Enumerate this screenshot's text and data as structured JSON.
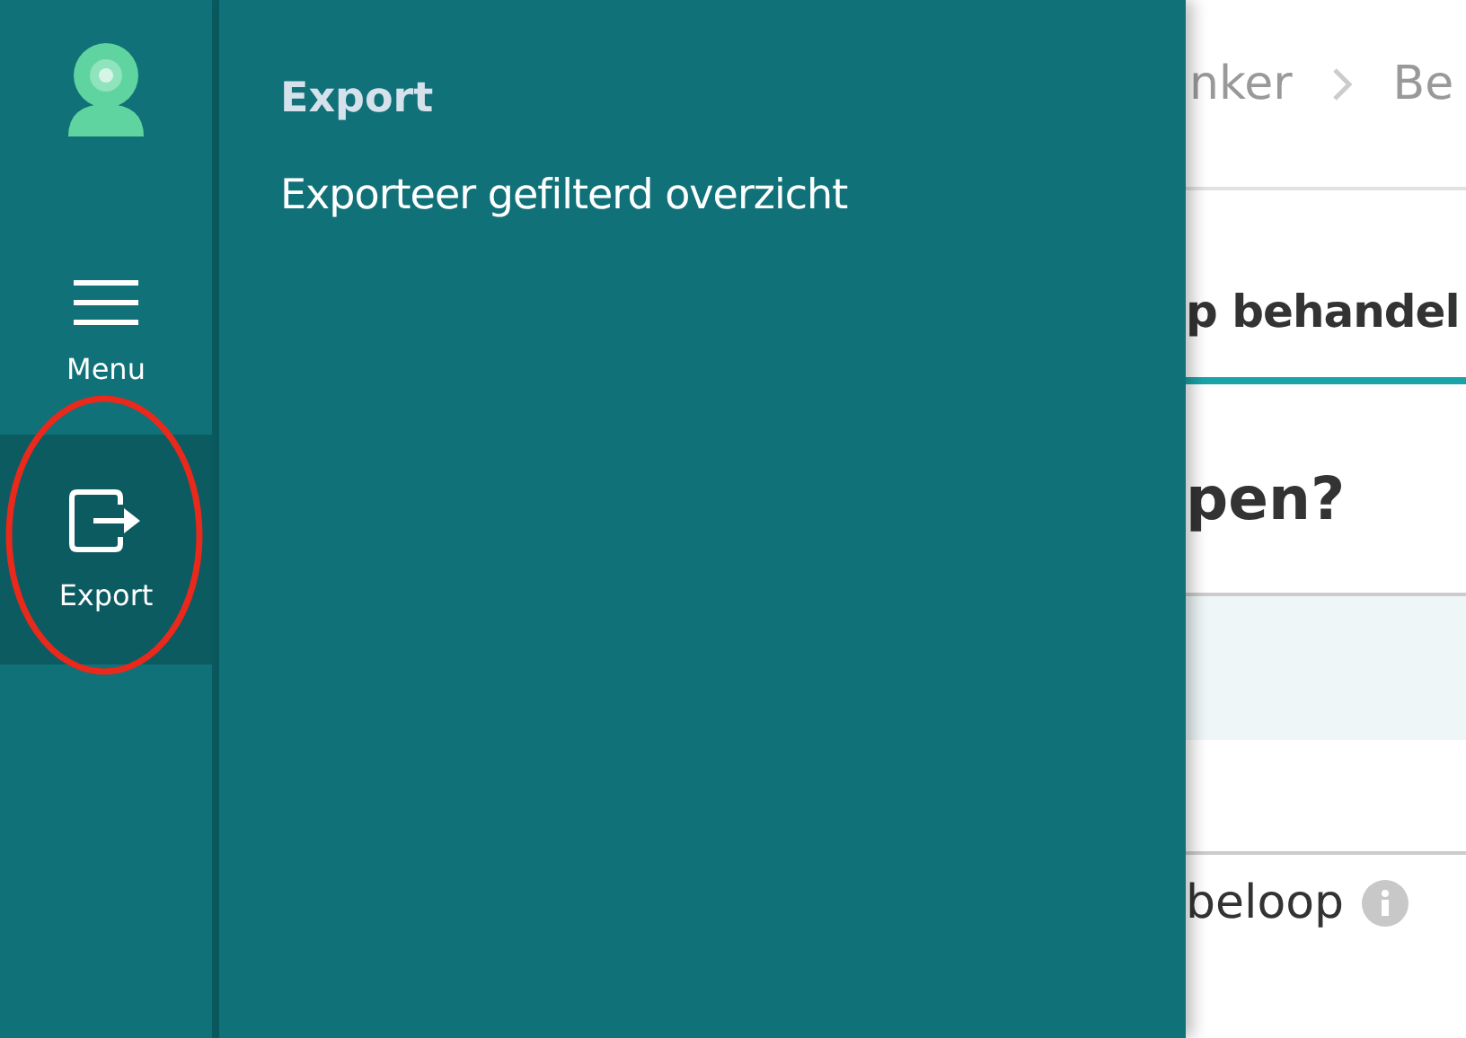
{
  "sidebar": {
    "items": [
      {
        "kind": "menu",
        "label": "Menu",
        "selected": false
      },
      {
        "kind": "export",
        "label": "Export",
        "selected": true
      }
    ]
  },
  "panel": {
    "title": "Export",
    "items": [
      "Exporteer gefilterd overzicht"
    ]
  },
  "content": {
    "breadcrumb": [
      "nker",
      "Be"
    ],
    "tab": "p behandel",
    "heading": "pen?",
    "row_label": "beloop"
  }
}
